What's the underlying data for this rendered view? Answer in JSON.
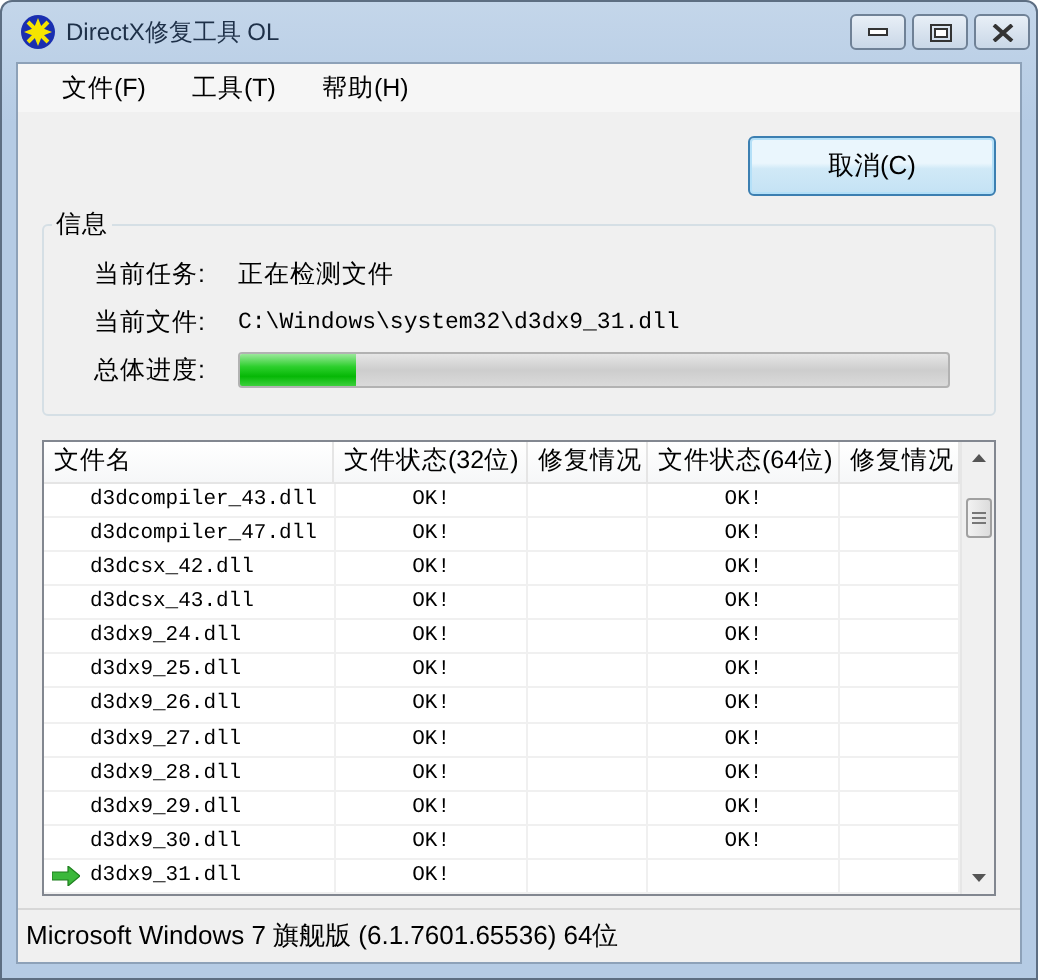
{
  "window": {
    "title": "DirectX修复工具 OL"
  },
  "menu": [
    "文件(F)",
    "工具(T)",
    "帮助(H)"
  ],
  "cancel_button": "取消(C)",
  "info": {
    "title": "信息",
    "task_label": "当前任务:",
    "task": "正在检测文件",
    "file_label": "当前文件:",
    "file": "C:\\Windows\\system32\\d3dx9_31.dll",
    "progress_label": "总体进度:",
    "level": 0.165
  },
  "table": {
    "columns": [
      "文件名",
      "文件状态(32位)",
      "修复情况",
      "文件状态(64位)",
      "修复情况"
    ],
    "rows": [
      {
        "name": "d3dcompiler_43.dll",
        "status32": "OK!",
        "status64": "OK!",
        "current": false
      },
      {
        "name": "d3dcompiler_47.dll",
        "status32": "OK!",
        "status64": "OK!",
        "current": false
      },
      {
        "name": "d3dcsx_42.dll",
        "status32": "OK!",
        "status64": "OK!",
        "current": false
      },
      {
        "name": "d3dcsx_43.dll",
        "status32": "OK!",
        "status64": "OK!",
        "current": false
      },
      {
        "name": "d3dx9_24.dll",
        "status32": "OK!",
        "status64": "OK!",
        "current": false
      },
      {
        "name": "d3dx9_25.dll",
        "status32": "OK!",
        "status64": "OK!",
        "current": false
      },
      {
        "name": "d3dx9_26.dll",
        "status32": "OK!",
        "status64": "OK!",
        "current": false
      },
      {
        "name": "d3dx9_27.dll",
        "status32": "OK!",
        "status64": "OK!",
        "current": false
      },
      {
        "name": "d3dx9_28.dll",
        "status32": "OK!",
        "status64": "OK!",
        "current": false
      },
      {
        "name": "d3dx9_29.dll",
        "status32": "OK!",
        "status64": "OK!",
        "current": false
      },
      {
        "name": "d3dx9_30.dll",
        "status32": "OK!",
        "status64": "OK!",
        "current": false
      },
      {
        "name": "d3dx9_31.dll",
        "status32": "OK!",
        "current": true
      }
    ]
  },
  "status_bar": "Microsoft Windows 7 旗舰版 (6.1.7601.65536) 64位"
}
